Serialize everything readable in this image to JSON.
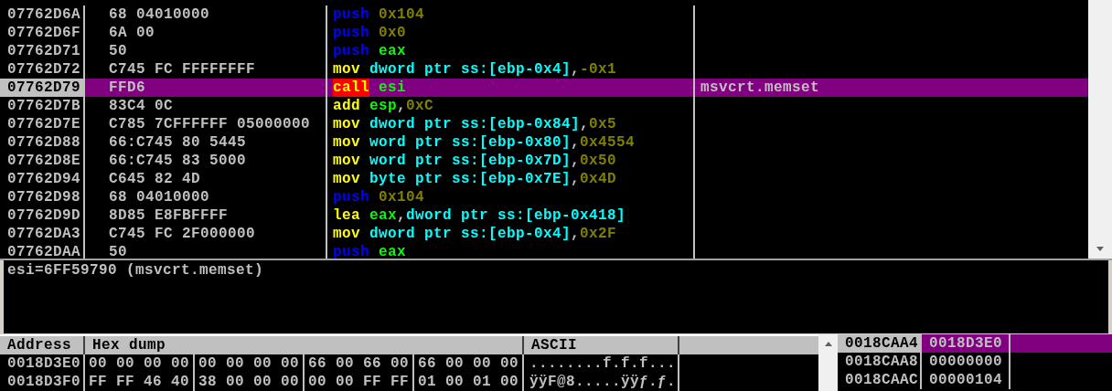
{
  "disassembly": {
    "rows": [
      {
        "address": "07762D6A",
        "hex": "68 04010000",
        "selected": false,
        "instruction": [
          {
            "text": "push",
            "kind": "push"
          },
          {
            "text": "0x104",
            "kind": "const"
          }
        ]
      },
      {
        "address": "07762D6F",
        "hex": "6A 00",
        "selected": false,
        "instruction": [
          {
            "text": "push",
            "kind": "push"
          },
          {
            "text": "0x0",
            "kind": "const"
          }
        ]
      },
      {
        "address": "07762D71",
        "hex": "50",
        "selected": false,
        "instruction": [
          {
            "text": "push",
            "kind": "push"
          },
          {
            "text": "eax",
            "kind": "reg"
          }
        ]
      },
      {
        "address": "07762D72",
        "hex": "C745 FC FFFFFFFF",
        "selected": false,
        "instruction": [
          {
            "text": "mov",
            "kind": "op"
          },
          {
            "text": "dword ptr ss:[ebp-0x4]",
            "kind": "mem"
          },
          {
            "text": ",",
            "kind": "sep"
          },
          {
            "text": "-0x1",
            "kind": "const"
          }
        ]
      },
      {
        "address": "07762D79",
        "hex": "FFD6",
        "selected": true,
        "instruction": [
          {
            "text": "call",
            "kind": "call"
          },
          {
            "text": "esi",
            "kind": "reg"
          }
        ],
        "comment": "msvcrt.memset"
      },
      {
        "address": "07762D7B",
        "hex": "83C4 0C",
        "selected": false,
        "instruction": [
          {
            "text": "add",
            "kind": "op"
          },
          {
            "text": "esp",
            "kind": "reg"
          },
          {
            "text": ",",
            "kind": "sep"
          },
          {
            "text": "0xC",
            "kind": "const"
          }
        ]
      },
      {
        "address": "07762D7E",
        "hex": "C785 7CFFFFFF 05000000",
        "selected": false,
        "instruction": [
          {
            "text": "mov",
            "kind": "op"
          },
          {
            "text": "dword ptr ss:[ebp-0x84]",
            "kind": "mem"
          },
          {
            "text": ",",
            "kind": "sep"
          },
          {
            "text": "0x5",
            "kind": "const"
          }
        ]
      },
      {
        "address": "07762D88",
        "hex": "66:C745 80 5445",
        "selected": false,
        "instruction": [
          {
            "text": "mov",
            "kind": "op"
          },
          {
            "text": "word ptr ss:[ebp-0x80]",
            "kind": "mem"
          },
          {
            "text": ",",
            "kind": "sep"
          },
          {
            "text": "0x4554",
            "kind": "const"
          }
        ]
      },
      {
        "address": "07762D8E",
        "hex": "66:C745 83 5000",
        "selected": false,
        "instruction": [
          {
            "text": "mov",
            "kind": "op"
          },
          {
            "text": "word ptr ss:[ebp-0x7D]",
            "kind": "mem"
          },
          {
            "text": ",",
            "kind": "sep"
          },
          {
            "text": "0x50",
            "kind": "const"
          }
        ]
      },
      {
        "address": "07762D94",
        "hex": "C645 82 4D",
        "selected": false,
        "instruction": [
          {
            "text": "mov",
            "kind": "op"
          },
          {
            "text": "byte ptr ss:[ebp-0x7E]",
            "kind": "mem"
          },
          {
            "text": ",",
            "kind": "sep"
          },
          {
            "text": "0x4D",
            "kind": "const"
          }
        ]
      },
      {
        "address": "07762D98",
        "hex": "68 04010000",
        "selected": false,
        "instruction": [
          {
            "text": "push",
            "kind": "push"
          },
          {
            "text": "0x104",
            "kind": "const"
          }
        ]
      },
      {
        "address": "07762D9D",
        "hex": "8D85 E8FBFFFF",
        "selected": false,
        "instruction": [
          {
            "text": "lea",
            "kind": "op"
          },
          {
            "text": "eax",
            "kind": "reg"
          },
          {
            "text": ",",
            "kind": "sep"
          },
          {
            "text": "dword ptr ss:[ebp-0x418]",
            "kind": "mem"
          }
        ]
      },
      {
        "address": "07762DA3",
        "hex": "C745 FC 2F000000",
        "selected": false,
        "instruction": [
          {
            "text": "mov",
            "kind": "op"
          },
          {
            "text": "dword ptr ss:[ebp-0x4]",
            "kind": "mem"
          },
          {
            "text": ",",
            "kind": "sep"
          },
          {
            "text": "0x2F",
            "kind": "const"
          }
        ]
      },
      {
        "address": "07762DAA",
        "hex": "50",
        "selected": false,
        "instruction": [
          {
            "text": "push",
            "kind": "push"
          },
          {
            "text": "eax",
            "kind": "reg"
          }
        ]
      }
    ]
  },
  "info_pane": {
    "text": "esi=6FF59790 (msvcrt.memset)"
  },
  "dump": {
    "columns": [
      "Address",
      "Hex dump",
      "ASCII"
    ],
    "rows": [
      {
        "address": "0018D3E0",
        "groups": [
          "00 00 00 00",
          "00 00 00 00",
          "66 00 66 00",
          "66 00 00 00"
        ],
        "ascii": "........f.f.f..."
      },
      {
        "address": "0018D3F0",
        "groups": [
          "FF FF 46 40",
          "38 00 00 00",
          "00 00 FF FF",
          "01 00 01 00"
        ],
        "ascii": "ÿÿF@8.....ÿÿƒ.ƒ."
      }
    ]
  },
  "stack": {
    "rows": [
      {
        "address": "0018CAA4",
        "value": "0018D3E0",
        "selected": true
      },
      {
        "address": "0018CAA8",
        "value": "00000000",
        "selected": false
      },
      {
        "address": "0018CAAC",
        "value": "00000104",
        "selected": false
      }
    ]
  }
}
